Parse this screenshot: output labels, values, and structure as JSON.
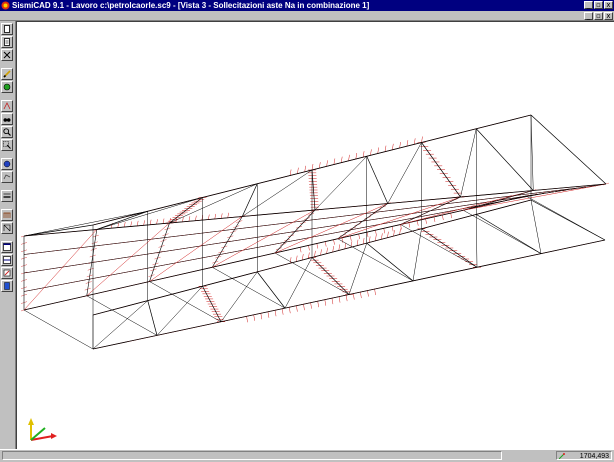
{
  "window": {
    "title": "SismiCAD 9.1 - Lavoro c:\\petrolcaorle.sc9 - [Vista 3 - Sollecitazioni aste Na in combinazione 1]",
    "minimize_symbol": "_",
    "maximize_symbol": "▫",
    "close_symbol": "x",
    "app_icon": "sismicad-logo-icon"
  },
  "toolbar": {
    "buttons": [
      {
        "icon": "new-document-icon"
      },
      {
        "icon": "open-document-icon"
      },
      {
        "icon": "tools-icon"
      },
      {
        "icon": "pencil-icon"
      },
      {
        "icon": "green-node-icon"
      },
      {
        "icon": "frame-icon"
      },
      {
        "icon": "binoculars-icon"
      },
      {
        "icon": "zoom-icon"
      },
      {
        "icon": "zoom-window-icon"
      },
      {
        "icon": "pan-icon"
      },
      {
        "icon": "rotate-icon"
      },
      {
        "icon": "layers-icon"
      },
      {
        "icon": "grid-icon"
      },
      {
        "icon": "structure-icon"
      },
      {
        "icon": "window-icon"
      },
      {
        "icon": "split-window-icon"
      },
      {
        "icon": "results-icon"
      },
      {
        "icon": "export-icon"
      }
    ]
  },
  "view": {
    "structure_color": "#000000",
    "diagram_color": "#d02020",
    "axes_colors": {
      "x": "#e02020",
      "y": "#20b020",
      "z": "#e0c000"
    }
  },
  "status": {
    "coordinates": "1704,493"
  }
}
